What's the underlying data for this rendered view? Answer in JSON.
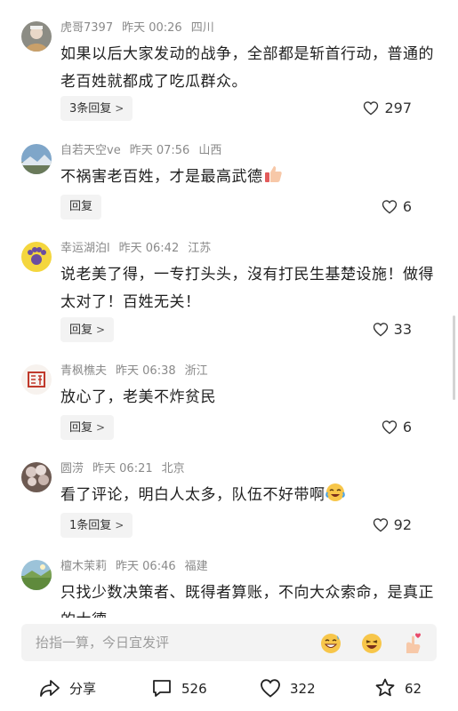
{
  "comments": [
    {
      "username": "虎哥7397",
      "time": "昨天 00:26",
      "location": "四川",
      "text": "如果以后大家发动的战争，全部都是斩首行动，普通的老百姓就都成了吃瓜群众。",
      "reply_label": "3条回复",
      "likes": "297",
      "avatar_icon": "person-photo-avatar"
    },
    {
      "username": "自若天空ve",
      "time": "昨天 07:56",
      "location": "山西",
      "text": "不祸害老百姓，才是最高武德",
      "emoji": "thumbs-up-emoji",
      "reply_label": "回复",
      "likes": "6",
      "avatar_icon": "mountain-sky-avatar"
    },
    {
      "username": "幸运湖泊l",
      "time": "昨天 06:42",
      "location": "江苏",
      "text": "说老美了得，一专打头头，沒有打民生基楚设施！做得太对了！百姓无关！",
      "reply_label": "回复",
      "likes": "33",
      "avatar_icon": "paw-avatar"
    },
    {
      "username": "青枫樵夫",
      "time": "昨天 06:38",
      "location": "浙江",
      "text": "放心了，老美不炸贫民",
      "reply_label": "回复",
      "likes": "6",
      "avatar_icon": "red-seal-avatar"
    },
    {
      "username": "圆涝",
      "time": "昨天 06:21",
      "location": "北京",
      "text": "看了评论，明白人太多，队伍不好带啊",
      "emoji": "crying-laughing-emoji",
      "reply_label": "1条回复",
      "likes": "92",
      "avatar_icon": "blossom-tree-avatar"
    },
    {
      "username": "檀木茉莉",
      "time": "昨天 06:46",
      "location": "福建",
      "text": "只找少数决策者、既得者算账，不向大众索命，是真正的大德",
      "avatar_icon": "landscape-avatar"
    }
  ],
  "input": {
    "placeholder": "抬指一算，今日宜发评"
  },
  "bottom_actions": {
    "share_label": "分享",
    "comment_count": "526",
    "like_count": "322",
    "favorite_count": "62"
  },
  "colors": {
    "meta_gray": "#8a8a8a",
    "pill_bg": "#f3f3f3",
    "text": "#1f1f1f"
  }
}
